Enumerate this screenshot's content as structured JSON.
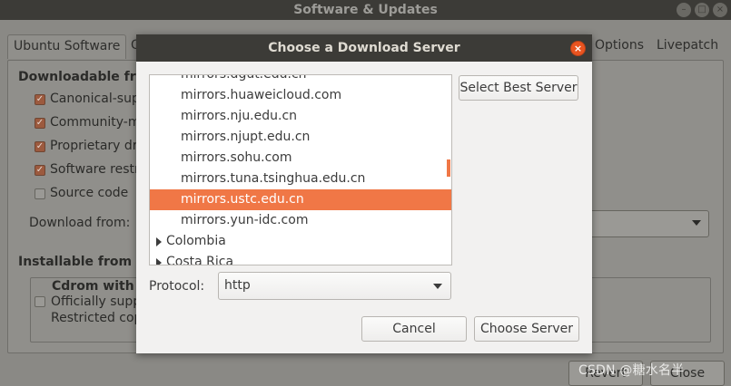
{
  "bg_window": {
    "title": "Software & Updates",
    "controls": {
      "minimize": "–",
      "maximize": "□",
      "close": "×"
    },
    "tabs": [
      "Ubuntu Software",
      "O",
      "Options",
      "Livepatch"
    ],
    "section_downloadable": "Downloadable fro",
    "checkboxes": [
      {
        "label": "Canonical-supp",
        "checked": true
      },
      {
        "label": "Community-m",
        "checked": true
      },
      {
        "label": "Proprietary dr",
        "checked": true
      },
      {
        "label": "Software restr",
        "checked": true
      },
      {
        "label": "Source code",
        "checked": false
      }
    ],
    "download_from_label": "Download from:",
    "section_installable": "Installable from C",
    "cdrom": {
      "title": "Cdrom with U",
      "line1": "Officially supp",
      "line2": "Restricted cop"
    },
    "revert_label": "Revert",
    "close_label": "Close",
    "watermark": "CSDN @糖水名半"
  },
  "dialog": {
    "title": "Choose a Download Server",
    "close_glyph": "×",
    "list_rows": [
      {
        "kind": "mirror",
        "label": "mirrors.dgut.edu.cn",
        "selected": false
      },
      {
        "kind": "mirror",
        "label": "mirrors.huaweicloud.com",
        "selected": false
      },
      {
        "kind": "mirror",
        "label": "mirrors.nju.edu.cn",
        "selected": false
      },
      {
        "kind": "mirror",
        "label": "mirrors.njupt.edu.cn",
        "selected": false
      },
      {
        "kind": "mirror",
        "label": "mirrors.sohu.com",
        "selected": false
      },
      {
        "kind": "mirror",
        "label": "mirrors.tuna.tsinghua.edu.cn",
        "selected": false
      },
      {
        "kind": "mirror",
        "label": "mirrors.ustc.edu.cn",
        "selected": true
      },
      {
        "kind": "mirror",
        "label": "mirrors.yun-idc.com",
        "selected": false
      },
      {
        "kind": "country",
        "label": "Colombia",
        "selected": false
      },
      {
        "kind": "country",
        "label": "Costa Rica",
        "selected": false
      }
    ],
    "select_best_label": "Select Best Server",
    "protocol_label": "Protocol:",
    "protocol_value": "http",
    "cancel_label": "Cancel",
    "choose_label": "Choose Server",
    "accent_color": "#f07746"
  }
}
